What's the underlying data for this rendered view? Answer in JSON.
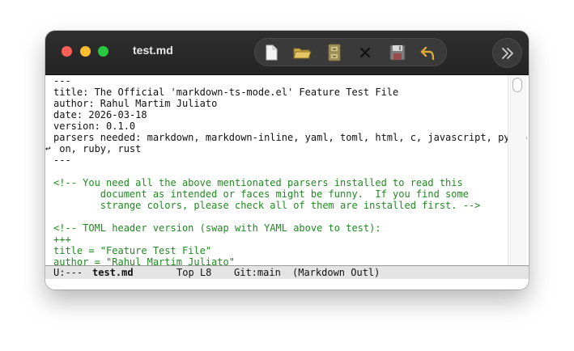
{
  "window": {
    "title": "test.md"
  },
  "toolbar": {
    "icons": [
      "new-file-icon",
      "open-folder-icon",
      "file-cabinet-icon",
      "close-icon",
      "save-icon",
      "undo-icon"
    ],
    "overflow_icon": "chevron-double-right-icon"
  },
  "editor": {
    "lines": [
      {
        "text": "---",
        "kind": "plain"
      },
      {
        "text": "title: The Official 'markdown-ts-mode.el' Feature Test File",
        "kind": "plain"
      },
      {
        "text": "author: Rahul Martim Juliato",
        "kind": "plain"
      },
      {
        "text": "date: 2026-03-18",
        "kind": "plain"
      },
      {
        "text": "version: 0.1.0",
        "kind": "plain"
      },
      {
        "text": "parsers needed: markdown, markdown-inline, yaml, toml, html, c, javascript, pytho",
        "kind": "plain"
      },
      {
        "text": " on, ruby, rust",
        "kind": "plain"
      },
      {
        "text": "---",
        "kind": "plain"
      },
      {
        "text": "",
        "kind": "plain"
      },
      {
        "text": "<!-- You need all the above mentionated parsers installed to read this",
        "kind": "comment"
      },
      {
        "text": "        document as intended or faces might be funny.  If you find some",
        "kind": "comment"
      },
      {
        "text": "        strange colors, please check all of them are installed first. -->",
        "kind": "comment"
      },
      {
        "text": "",
        "kind": "plain"
      },
      {
        "text": "<!-- TOML header version (swap with YAML above to test):",
        "kind": "comment"
      },
      {
        "text": "+++",
        "kind": "toml"
      },
      {
        "text": "title = \"Feature Test File\"",
        "kind": "toml"
      },
      {
        "text": "author = \"Rahul Martim Juliato\"",
        "kind": "toml"
      }
    ],
    "wrap_glyph": "↩"
  },
  "modeline": {
    "state": "U:---",
    "buffer": "test.md",
    "position": "Top L8",
    "vc": "Git:main",
    "mode": "(Markdown Outl)"
  }
}
